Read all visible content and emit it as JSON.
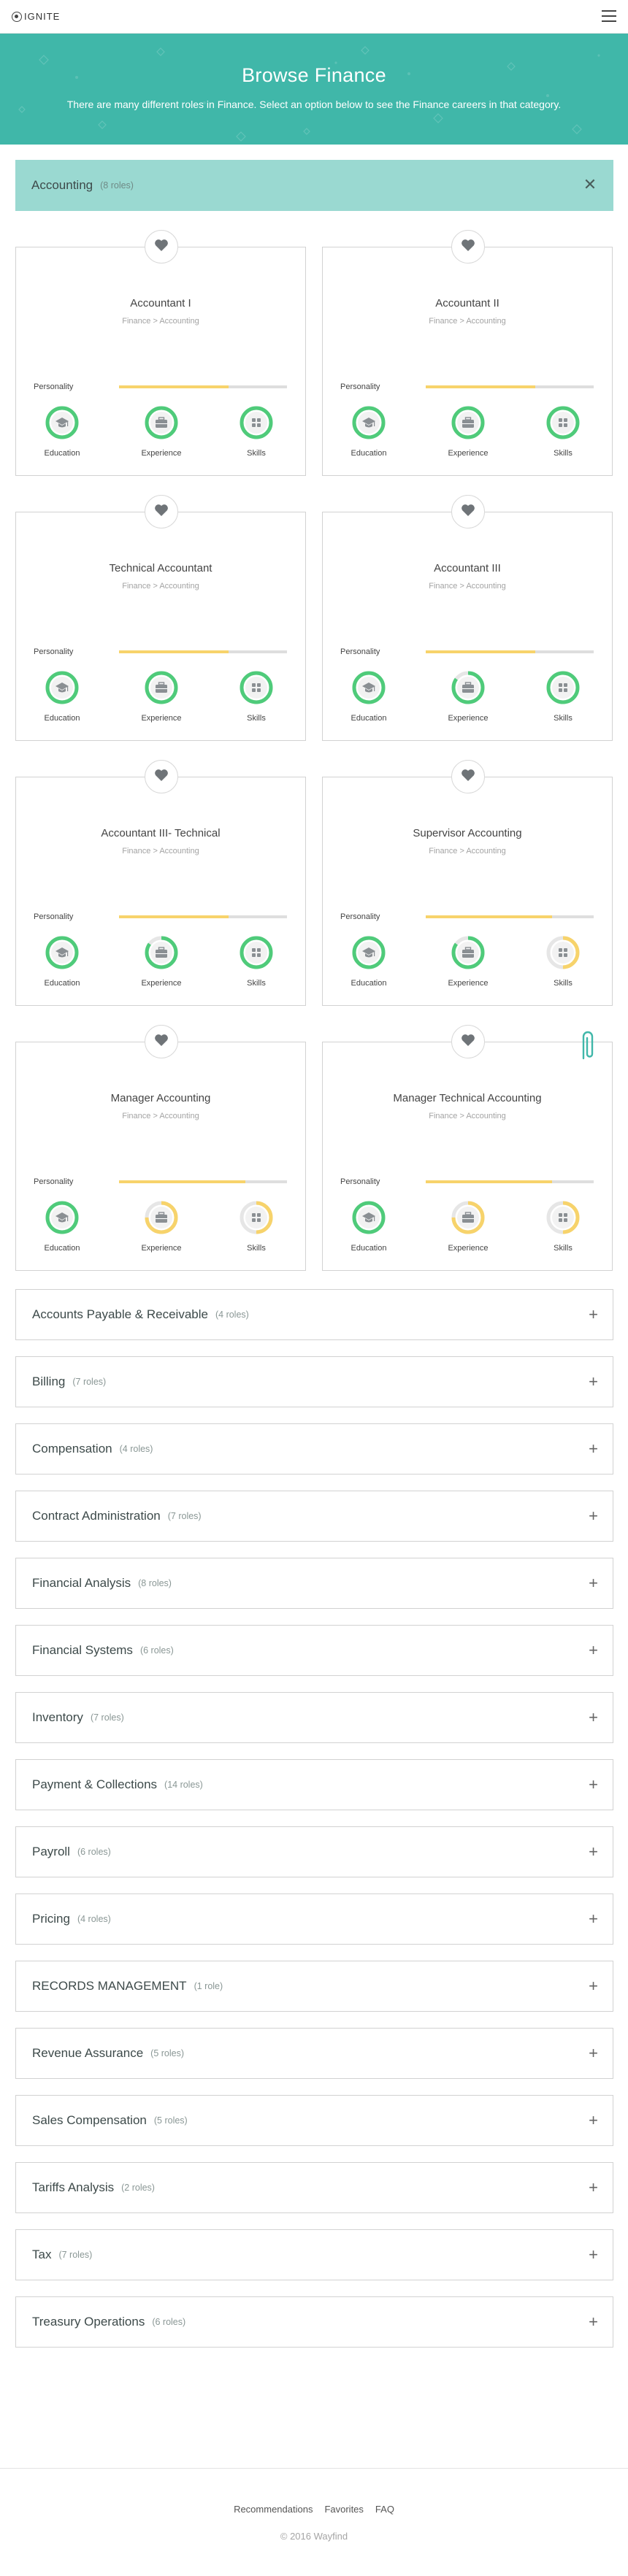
{
  "nav": {
    "logo_text": "IGNITE"
  },
  "hero": {
    "title": "Browse Finance",
    "subtitle": "There are many different roles in Finance. Select an option below to see the Finance careers in that category.",
    "bg_color": "#40b7a9"
  },
  "open_category": {
    "title": "Accounting",
    "count": "(8 roles)"
  },
  "cards": [
    {
      "title": "Accountant I",
      "crumb": "Finance > Accounting",
      "personality_label": "Personality",
      "personality_level": 0.65,
      "education": {
        "label": "Education",
        "level": 1.0,
        "color": "#4fcb7a"
      },
      "experience": {
        "label": "Experience",
        "level": 1.0,
        "color": "#4fcb7a"
      },
      "skills": {
        "label": "Skills",
        "level": 1.0,
        "color": "#4fcb7a"
      }
    },
    {
      "title": "Accountant II",
      "crumb": "Finance > Accounting",
      "personality_label": "Personality",
      "personality_level": 0.65,
      "education": {
        "label": "Education",
        "level": 1.0,
        "color": "#4fcb7a"
      },
      "experience": {
        "label": "Experience",
        "level": 1.0,
        "color": "#4fcb7a"
      },
      "skills": {
        "label": "Skills",
        "level": 1.0,
        "color": "#4fcb7a"
      }
    },
    {
      "title": "Technical Accountant",
      "crumb": "Finance > Accounting",
      "personality_label": "Personality",
      "personality_level": 0.65,
      "education": {
        "label": "Education",
        "level": 1.0,
        "color": "#4fcb7a"
      },
      "experience": {
        "label": "Experience",
        "level": 1.0,
        "color": "#4fcb7a"
      },
      "skills": {
        "label": "Skills",
        "level": 1.0,
        "color": "#4fcb7a"
      }
    },
    {
      "title": "Accountant III",
      "crumb": "Finance > Accounting",
      "personality_label": "Personality",
      "personality_level": 0.65,
      "education": {
        "label": "Education",
        "level": 1.0,
        "color": "#4fcb7a"
      },
      "experience": {
        "label": "Experience",
        "level": 0.85,
        "color": "#4fcb7a"
      },
      "skills": {
        "label": "Skills",
        "level": 1.0,
        "color": "#4fcb7a"
      }
    },
    {
      "title": "Accountant III- Technical",
      "crumb": "Finance > Accounting",
      "personality_label": "Personality",
      "personality_level": 0.65,
      "education": {
        "label": "Education",
        "level": 1.0,
        "color": "#4fcb7a"
      },
      "experience": {
        "label": "Experience",
        "level": 0.85,
        "color": "#4fcb7a"
      },
      "skills": {
        "label": "Skills",
        "level": 1.0,
        "color": "#4fcb7a"
      }
    },
    {
      "title": "Supervisor Accounting",
      "crumb": "Finance > Accounting",
      "personality_label": "Personality",
      "personality_level": 0.75,
      "education": {
        "label": "Education",
        "level": 1.0,
        "color": "#4fcb7a"
      },
      "experience": {
        "label": "Experience",
        "level": 0.85,
        "color": "#4fcb7a"
      },
      "skills": {
        "label": "Skills",
        "level": 0.5,
        "color": "#f7d36b"
      }
    },
    {
      "title": "Manager Accounting",
      "crumb": "Finance > Accounting",
      "personality_label": "Personality",
      "personality_level": 0.75,
      "education": {
        "label": "Education",
        "level": 1.0,
        "color": "#4fcb7a"
      },
      "experience": {
        "label": "Experience",
        "level": 0.75,
        "color": "#f7d36b"
      },
      "skills": {
        "label": "Skills",
        "level": 0.5,
        "color": "#f7d36b"
      }
    },
    {
      "title": "Manager Technical Accounting",
      "crumb": "Finance > Accounting",
      "personality_label": "Personality",
      "personality_level": 0.75,
      "education": {
        "label": "Education",
        "level": 1.0,
        "color": "#4fcb7a"
      },
      "experience": {
        "label": "Experience",
        "level": 0.75,
        "color": "#f7d36b"
      },
      "skills": {
        "label": "Skills",
        "level": 0.5,
        "color": "#f7d36b"
      }
    }
  ],
  "categories": [
    {
      "title": "Accounts Payable & Receivable",
      "count": "(4 roles)"
    },
    {
      "title": "Billing",
      "count": "(7 roles)"
    },
    {
      "title": "Compensation",
      "count": "(4 roles)"
    },
    {
      "title": "Contract Administration",
      "count": "(7 roles)"
    },
    {
      "title": "Financial Analysis",
      "count": "(8 roles)"
    },
    {
      "title": "Financial Systems",
      "count": "(6 roles)"
    },
    {
      "title": "Inventory",
      "count": "(7 roles)"
    },
    {
      "title": "Payment & Collections",
      "count": "(14 roles)"
    },
    {
      "title": "Payroll",
      "count": "(6 roles)"
    },
    {
      "title": "Pricing",
      "count": "(4 roles)"
    },
    {
      "title": "RECORDS MANAGEMENT",
      "count": "(1 role)"
    },
    {
      "title": "Revenue Assurance",
      "count": "(5 roles)"
    },
    {
      "title": "Sales Compensation",
      "count": "(5 roles)"
    },
    {
      "title": "Tariffs Analysis",
      "count": "(2 roles)"
    },
    {
      "title": "Tax",
      "count": "(7 roles)"
    },
    {
      "title": "Treasury Operations",
      "count": "(6 roles)"
    }
  ],
  "footer": {
    "links": [
      "Recommendations",
      "Favorites",
      "FAQ"
    ],
    "copyright": "© 2016 Wayfind"
  },
  "colors": {
    "accent": "#40b7a9",
    "accordion_open": "#9ad9d1",
    "success": "#4fcb7a",
    "warning": "#f7d36b"
  }
}
